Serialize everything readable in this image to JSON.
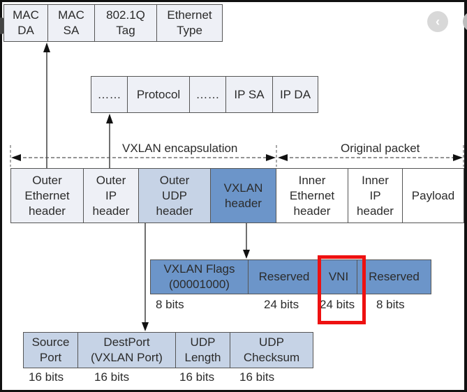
{
  "ethernet_header_fields": [
    {
      "label": "MAC\nDA"
    },
    {
      "label": "MAC\nSA"
    },
    {
      "label": "802.1Q\nTag"
    },
    {
      "label": "Ethernet\nType"
    }
  ],
  "ip_header_fields": [
    {
      "label": "……"
    },
    {
      "label": "Protocol"
    },
    {
      "label": "……"
    },
    {
      "label": "IP SA"
    },
    {
      "label": "IP DA"
    }
  ],
  "span_labels": {
    "vxlan_encapsulation": "VXLAN encapsulation",
    "original_packet": "Original packet"
  },
  "packet_segments": [
    {
      "label": "Outer\nEthernet\nheader"
    },
    {
      "label": "Outer\nIP\nheader"
    },
    {
      "label": "Outer\nUDP\nheader"
    },
    {
      "label": "VXLAN\nheader"
    },
    {
      "label": "Inner\nEthernet\nheader"
    },
    {
      "label": "Inner\nIP\nheader"
    },
    {
      "label": "Payload"
    }
  ],
  "vxlan_header_fields": [
    {
      "label": "VXLAN Flags\n(00001000)",
      "bits": "8 bits"
    },
    {
      "label": "Reserved",
      "bits": "24 bits"
    },
    {
      "label": "VNI",
      "bits": "24 bits"
    },
    {
      "label": "Reserved",
      "bits": "8 bits"
    }
  ],
  "udp_header_fields": [
    {
      "label": "Source\nPort",
      "bits": "16 bits"
    },
    {
      "label": "DestPort\n(VXLAN Port)",
      "bits": "16 bits"
    },
    {
      "label": "UDP\nLength",
      "bits": "16 bits"
    },
    {
      "label": "UDP\nChecksum",
      "bits": "16 bits"
    }
  ],
  "highlight": {
    "field": "VNI",
    "color": "#ee1111"
  },
  "colors": {
    "light_cell": "#eef0f6",
    "mid_cell": "#c6d3e6",
    "blue_cell": "#6c95c9"
  },
  "nav": {
    "prev_icon": "chevron-left-icon"
  }
}
